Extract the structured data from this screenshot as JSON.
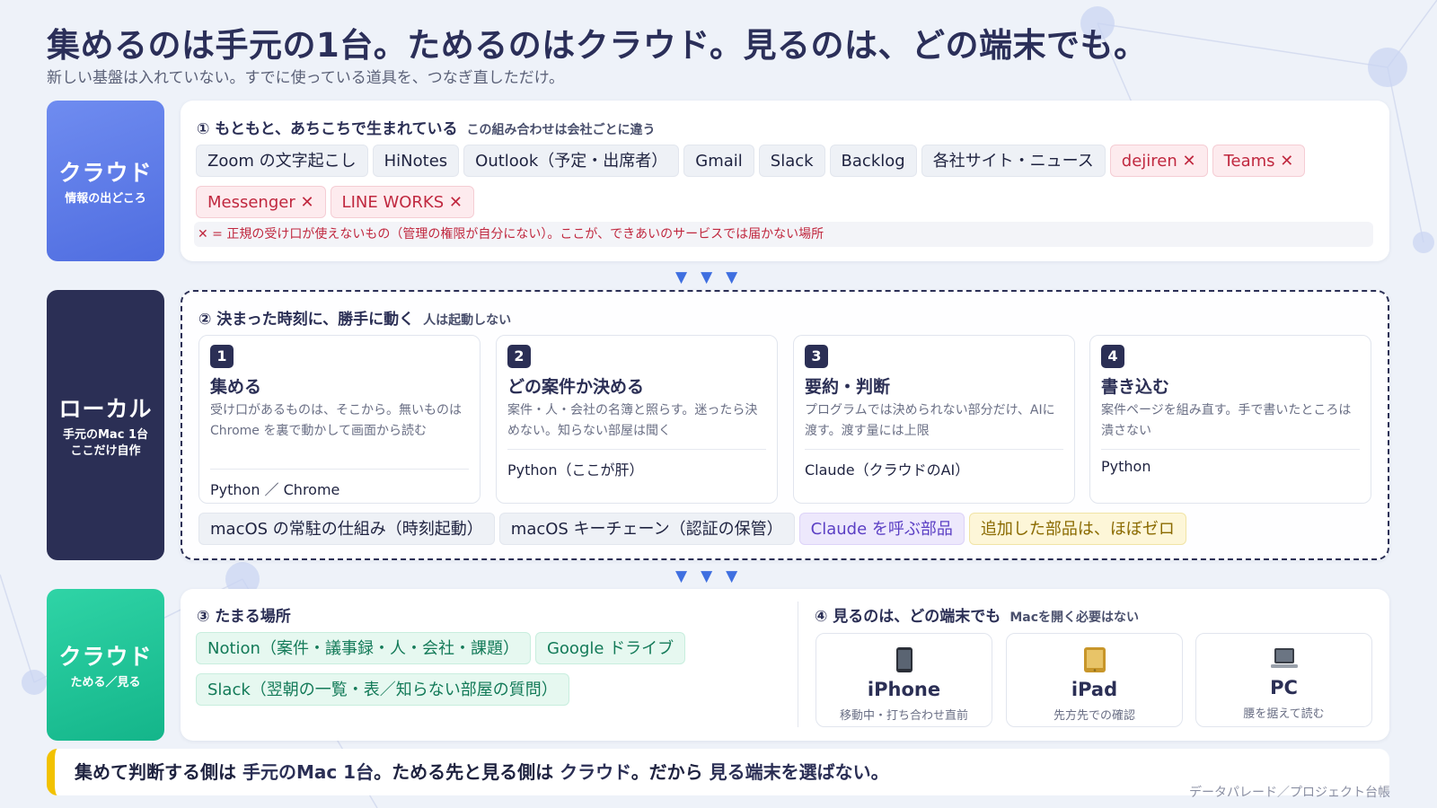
{
  "header": {
    "title": "集めるのは手元の1台。ためるのはクラウド。見るのは、どの端末でも。",
    "subtitle": "新しい基盤は入れていない。すでに使っている道具を、つなぎ直しただけ。"
  },
  "rows": {
    "cloud_source": {
      "title": "クラウド",
      "sub": "情報の出どころ"
    },
    "local": {
      "title": "ローカル",
      "sub1": "手元のMac 1台",
      "sub2": "ここだけ自作"
    },
    "cloud_store": {
      "title": "クラウド",
      "sub": "ためる／見る"
    }
  },
  "section1": {
    "heading": "① もともと、あちこちで生まれている",
    "note": "この組み合わせは会社ごとに違う",
    "chips": [
      {
        "label": "Zoom の文字起こし",
        "kind": "gray"
      },
      {
        "label": "HiNotes",
        "kind": "gray"
      },
      {
        "label": "Outlook（予定・出席者）",
        "kind": "gray"
      },
      {
        "label": "Gmail",
        "kind": "gray"
      },
      {
        "label": "Slack",
        "kind": "gray"
      },
      {
        "label": "Backlog",
        "kind": "gray"
      },
      {
        "label": "各社サイト・ニュース",
        "kind": "gray"
      },
      {
        "label": "dejiren ✕",
        "kind": "red"
      },
      {
        "label": "Teams ✕",
        "kind": "red"
      },
      {
        "label": "Messenger ✕",
        "kind": "red"
      },
      {
        "label": "LINE WORKS ✕",
        "kind": "red"
      }
    ],
    "x_note": "✕ = 正規の受け口が使えないもの（管理の権限が自分にない）。ここが、できあいのサービスでは届かない場所"
  },
  "arrow_glyph": "▼",
  "section2": {
    "heading": "② 決まった時刻に、勝手に動く",
    "note": "人は起動しない",
    "steps": [
      {
        "num": "1",
        "title": "集める",
        "desc": "受け口があるものは、そこから。無いものは Chrome を裏で動かして画面から読む",
        "tool": "Python ／ Chrome"
      },
      {
        "num": "2",
        "title": "どの案件か決める",
        "desc": "案件・人・会社の名簿と照らす。迷ったら決めない。知らない部屋は聞く",
        "tool": "Python（ここが肝）"
      },
      {
        "num": "3",
        "title": "要約・判断",
        "desc": "プログラムでは決められない部分だけ、AIに渡す。渡す量には上限",
        "tool": "Claude（クラウドのAI）"
      },
      {
        "num": "4",
        "title": "書き込む",
        "desc": "案件ページを組み直す。手で書いたところは潰さない",
        "tool": "Python"
      }
    ],
    "chips": [
      {
        "label": "macOS の常駐の仕組み（時刻起動）",
        "kind": "gray"
      },
      {
        "label": "macOS キーチェーン（認証の保管）",
        "kind": "gray"
      },
      {
        "label": "Claude を呼ぶ部品",
        "kind": "purple"
      },
      {
        "label": "追加した部品は、ほぼゼロ",
        "kind": "yellow"
      }
    ]
  },
  "section3": {
    "heading": "③ たまる場所",
    "chips": [
      {
        "label": "Notion（案件・議事録・人・会社・課題）",
        "kind": "green"
      },
      {
        "label": "Google ドライブ",
        "kind": "green"
      },
      {
        "label": "Slack（翌朝の一覧・表／知らない部屋の質問）",
        "kind": "green"
      }
    ]
  },
  "section4": {
    "heading": "④ 見るのは、どの端末でも",
    "note": "Macを開く必要はない",
    "devices": [
      {
        "name": "iPhone",
        "desc": "移動中・打ち合わせ直前",
        "icon": "smartphone-icon"
      },
      {
        "name": "iPad",
        "desc": "先方先での確認",
        "icon": "tablet-icon"
      },
      {
        "name": "PC",
        "desc": "腰を据えて読む",
        "icon": "laptop-icon"
      }
    ]
  },
  "summary": {
    "p1": "集めて判断する側は",
    "h1": "手元のMac 1台",
    "p2": "。ためる先と見る側は",
    "h2": "クラウド",
    "p3": "。だから",
    "h3": "見る端末を選ばない。"
  },
  "footer": "データパレード／プロジェクト台帳",
  "colors": {
    "accent_blue": "#4f6de0",
    "navy": "#2b2f55",
    "green": "#14b58a",
    "red": "#c0283f",
    "yellow": "#f2c200"
  }
}
